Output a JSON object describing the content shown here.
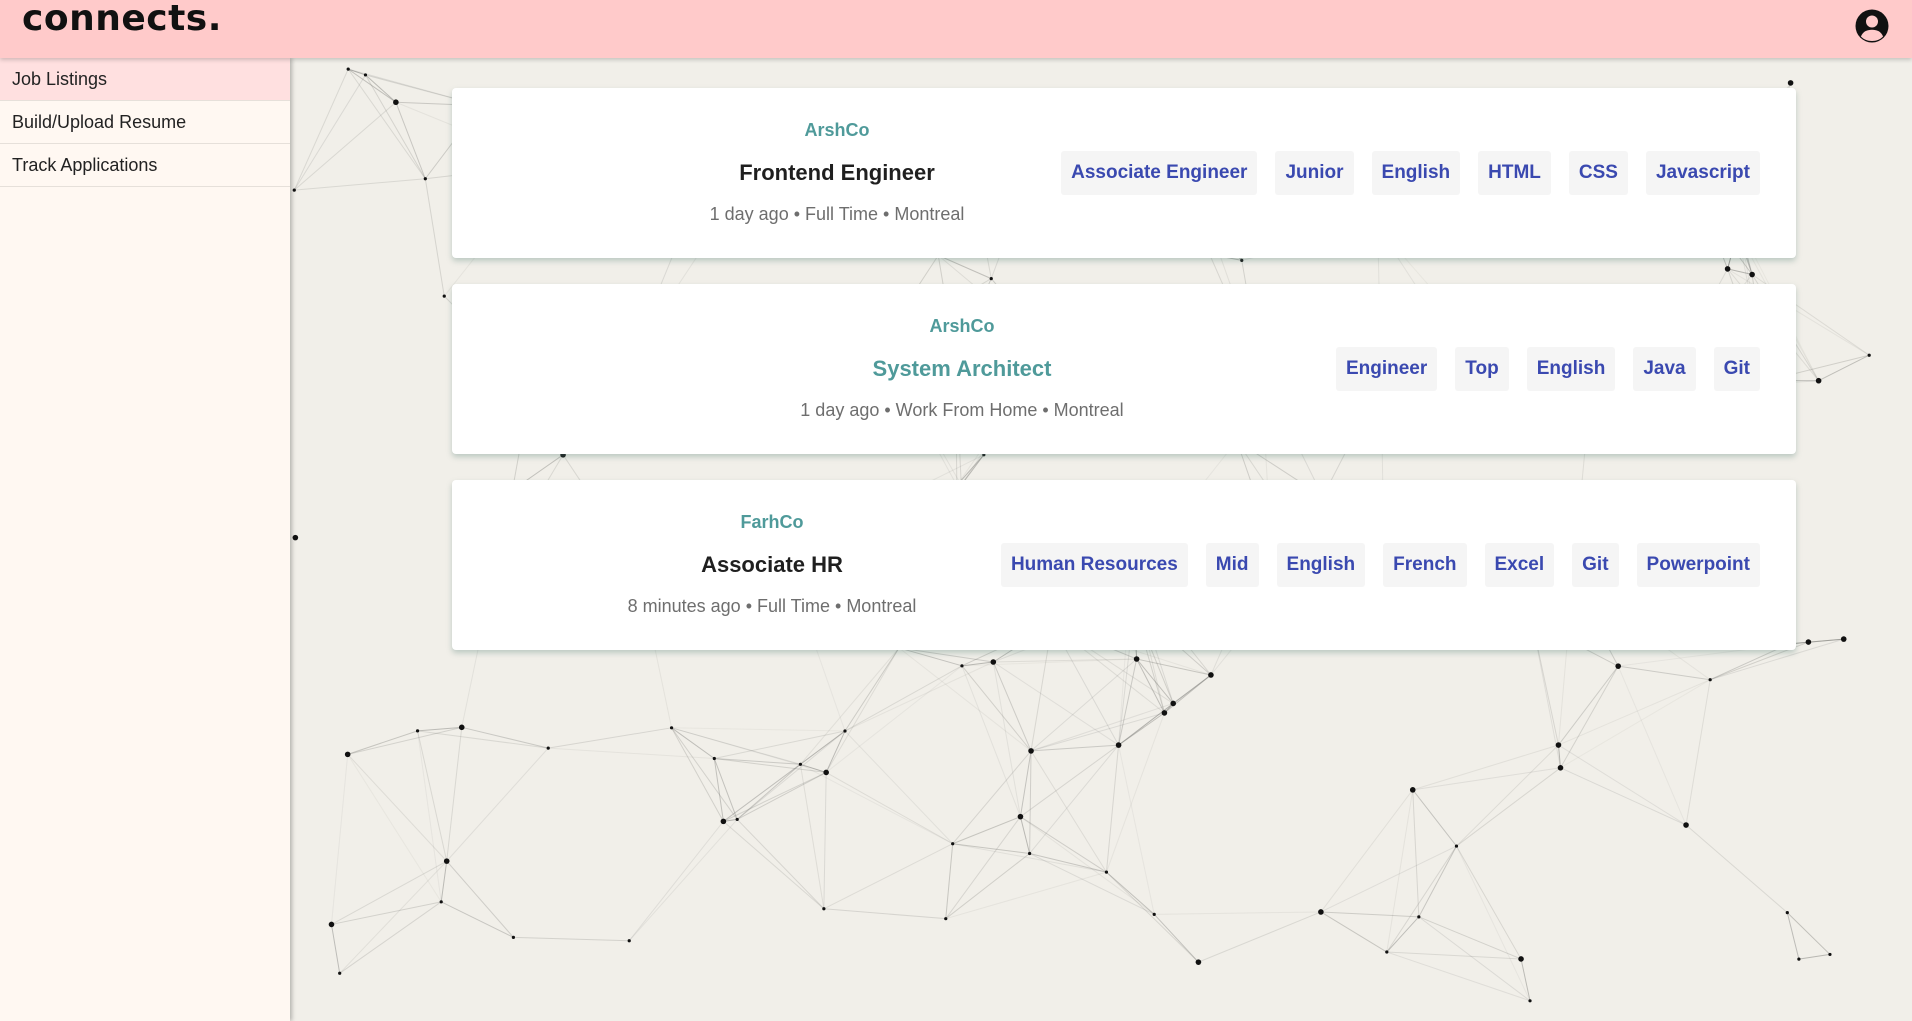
{
  "header": {
    "brand": "connects.",
    "account_icon": "account-circle-icon"
  },
  "sidebar": {
    "items": [
      {
        "label": "Job Listings",
        "active": true
      },
      {
        "label": "Build/Upload Resume",
        "active": false
      },
      {
        "label": "Track Applications",
        "active": false
      }
    ]
  },
  "jobs": [
    {
      "company": "ArshCo",
      "title": "Frontend Engineer",
      "meta": "1 day ago • Full Time • Montreal",
      "tags": [
        "Associate Engineer",
        "Junior",
        "English",
        "HTML",
        "CSS",
        "Javascript"
      ]
    },
    {
      "company": "ArshCo",
      "title": "System Architect",
      "meta": "1 day ago • Work From Home • Montreal",
      "tags": [
        "Engineer",
        "Top",
        "English",
        "Java",
        "Git"
      ]
    },
    {
      "company": "FarhCo",
      "title": "Associate HR",
      "meta": "8 minutes ago • Full Time • Montreal",
      "tags": [
        "Human Resources",
        "Mid",
        "English",
        "French",
        "Excel",
        "Git",
        "Powerpoint"
      ]
    }
  ],
  "colors": {
    "header_bg": "#ffcaca",
    "sidebar_bg": "#fff8f2",
    "company_text": "#4f9a9a",
    "tag_text": "#3a49b0",
    "background": "#f1efe9"
  }
}
